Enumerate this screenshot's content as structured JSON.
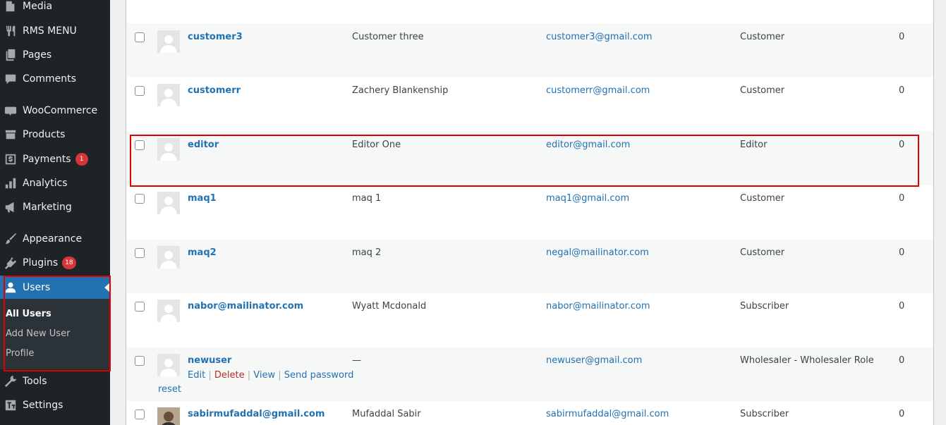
{
  "sidebar": {
    "items": [
      {
        "label": "Media",
        "icon": "media-icon"
      },
      {
        "label": "RMS MENU",
        "icon": "cutlery-icon"
      },
      {
        "label": "Pages",
        "icon": "pages-icon"
      },
      {
        "label": "Comments",
        "icon": "comments-icon"
      },
      {
        "label": "WooCommerce",
        "icon": "woocommerce-icon"
      },
      {
        "label": "Products",
        "icon": "products-icon"
      },
      {
        "label": "Payments",
        "icon": "payments-icon",
        "badge": "1"
      },
      {
        "label": "Analytics",
        "icon": "analytics-icon"
      },
      {
        "label": "Marketing",
        "icon": "megaphone-icon"
      },
      {
        "label": "Appearance",
        "icon": "paintbrush-icon"
      },
      {
        "label": "Plugins",
        "icon": "plugins-icon",
        "badge": "18"
      },
      {
        "label": "Users",
        "icon": "users-icon"
      },
      {
        "label": "Tools",
        "icon": "tools-icon"
      },
      {
        "label": "Settings",
        "icon": "settings-icon"
      }
    ],
    "submenu": [
      "All Users",
      "Add New User",
      "Profile"
    ]
  },
  "users": [
    {
      "username": "customer3",
      "name": "Customer three",
      "email": "customer3@gmail.com",
      "role": "Customer",
      "posts": "0"
    },
    {
      "username": "customerr",
      "name": "Zachery Blankenship",
      "email": "customerr@gmail.com",
      "role": "Customer",
      "posts": "0"
    },
    {
      "username": "editor",
      "name": "Editor One",
      "email": "editor@gmail.com",
      "role": "Editor",
      "posts": "0"
    },
    {
      "username": "maq1",
      "name": "maq 1",
      "email": "maq1@gmail.com",
      "role": "Customer",
      "posts": "0"
    },
    {
      "username": "maq2",
      "name": "maq 2",
      "email": "negal@mailinator.com",
      "role": "Customer",
      "posts": "0"
    },
    {
      "username": "nabor@mailinator.com",
      "name": "Wyatt Mcdonald",
      "email": "nabor@mailinator.com",
      "role": "Subscriber",
      "posts": "0"
    },
    {
      "username": "newuser",
      "name": "—",
      "email": "newuser@gmail.com",
      "role": "Wholesaler - Wholesaler Role",
      "posts": "0"
    },
    {
      "username": "sabirmufaddal@gmail.com",
      "name": "Mufaddal Sabir",
      "email": "sabirmufaddal@gmail.com",
      "role": "Subscriber",
      "posts": "0"
    }
  ],
  "row_actions": {
    "edit": "Edit",
    "delete": "Delete",
    "view": "View",
    "send_password": "Send password",
    "reset": "reset",
    "sep": "|"
  },
  "colors": {
    "sidebar_bg": "#1d2327",
    "accent": "#2271b1",
    "highlight_border": "#e00000",
    "badge": "#d63638"
  }
}
